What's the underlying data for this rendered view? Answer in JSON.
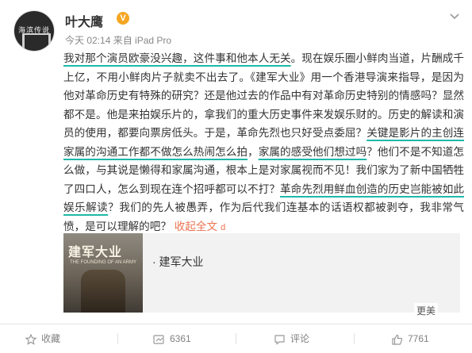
{
  "author": {
    "name": "叶大鹰",
    "verified_badge": "V",
    "avatar_text": "海滨传说"
  },
  "meta": {
    "time": "今天 02:14",
    "source": "来自 iPad Pro"
  },
  "post": {
    "seg1": "我对那个演员欧豪没兴趣，这件事和他本人无关",
    "seg2": "。现在娱乐圈小鲜肉当道，片酬成千上亿，不用小鲜肉片子就卖不出去了。《建军大业》用一个香港导演来指导，是因为他对革命历史有特殊的研究？还是他过去的作品中有对革命历史特别的情感吗？显然都不是。他是来拍娱乐片的，拿我们的重大历史事件来发娱乐财的。历史的解读和演员的使用，都要向票房低头。于是，革命先烈也只好受点委屈？",
    "seg3": "关键是影片的主创连家属的沟通工作都不做怎么热闹怎么拍",
    "seg4": "，",
    "seg5": "家属的感受他们想过吗",
    "seg6": "？他们不是不知道怎么做，与其说是懒得和家属沟通，根本上是对家属视而不见！我们家为了新中国牺牲了四口人，怎么到现在连个招呼都可以不打？",
    "seg7": "革命先烈用鲜血创造的历史岂能被如此娱乐解读",
    "seg8": "？我们的先人被愚弄，作为后代我们连基本的话语权都被剥夺，我非常气愤，是可以理解的吧？ ",
    "collapse_label": "收起全文",
    "collapse_icon": "d"
  },
  "card": {
    "poster_title": "建军大业",
    "poster_subtitle": "THE FOUNDING OF AN ARMY",
    "title": "· 建军大业"
  },
  "toolbar": {
    "favorite_label": "收藏",
    "repost_count": "6361",
    "comment_label": "评论",
    "like_count": "7761"
  },
  "watermark": "更美",
  "colors": {
    "accent": "#eb7350",
    "highlight": "#1fb8a8",
    "text": "#333333",
    "muted": "#808080"
  }
}
